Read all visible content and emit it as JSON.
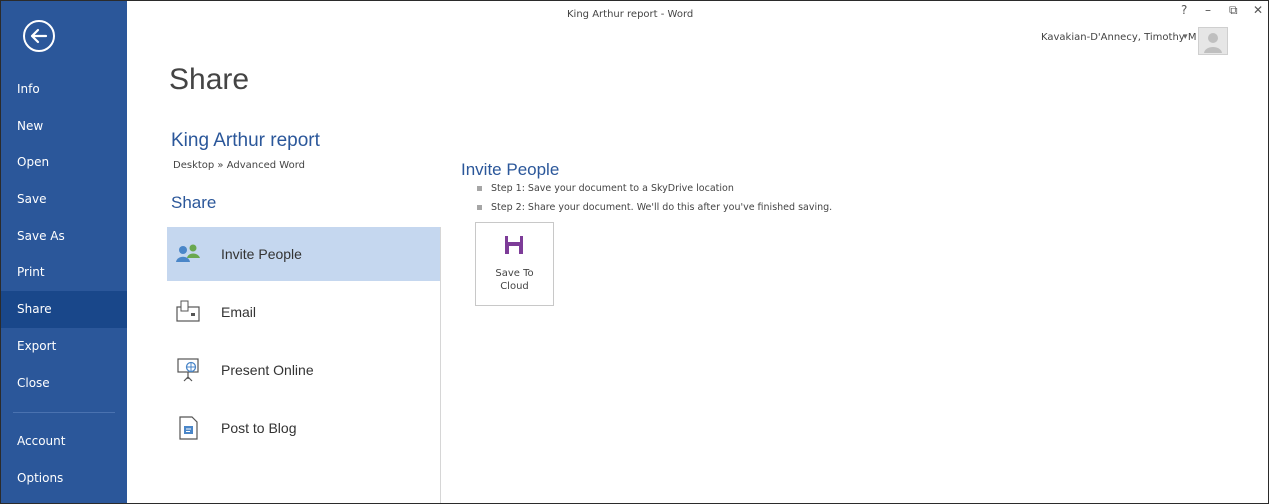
{
  "window": {
    "title": "King Arthur report - Word",
    "help": "?",
    "minimize": "–",
    "restore": "⧉",
    "close": "✕"
  },
  "user": {
    "name": "Kavakian-D'Annecy, Timothy M",
    "menu_arrow": "▾"
  },
  "nav": {
    "back_icon": "back-arrow-icon",
    "items": [
      "Info",
      "New",
      "Open",
      "Save",
      "Save As",
      "Print",
      "Share",
      "Export",
      "Close"
    ],
    "bottom_items": [
      "Account",
      "Options"
    ],
    "selected": "Share",
    "color": "#2b579a"
  },
  "main": {
    "page_title": "Share",
    "doc_name": "King Arthur report",
    "doc_path": "Desktop » Advanced Word",
    "share_heading": "Share",
    "options": [
      {
        "label": "Invite People",
        "icon": "invite-people-icon"
      },
      {
        "label": "Email",
        "icon": "email-icon"
      },
      {
        "label": "Present Online",
        "icon": "present-online-icon"
      },
      {
        "label": "Post to Blog",
        "icon": "post-to-blog-icon"
      }
    ],
    "selected_option": "Invite People"
  },
  "detail": {
    "title": "Invite People",
    "steps": [
      "Step 1: Save your document to a SkyDrive location",
      "Step 2: Share your document. We'll do this after you've finished saving."
    ],
    "save_button": {
      "line1": "Save To",
      "line2": "Cloud",
      "icon": "save-disk-icon",
      "accent": "#7d3c98"
    }
  }
}
